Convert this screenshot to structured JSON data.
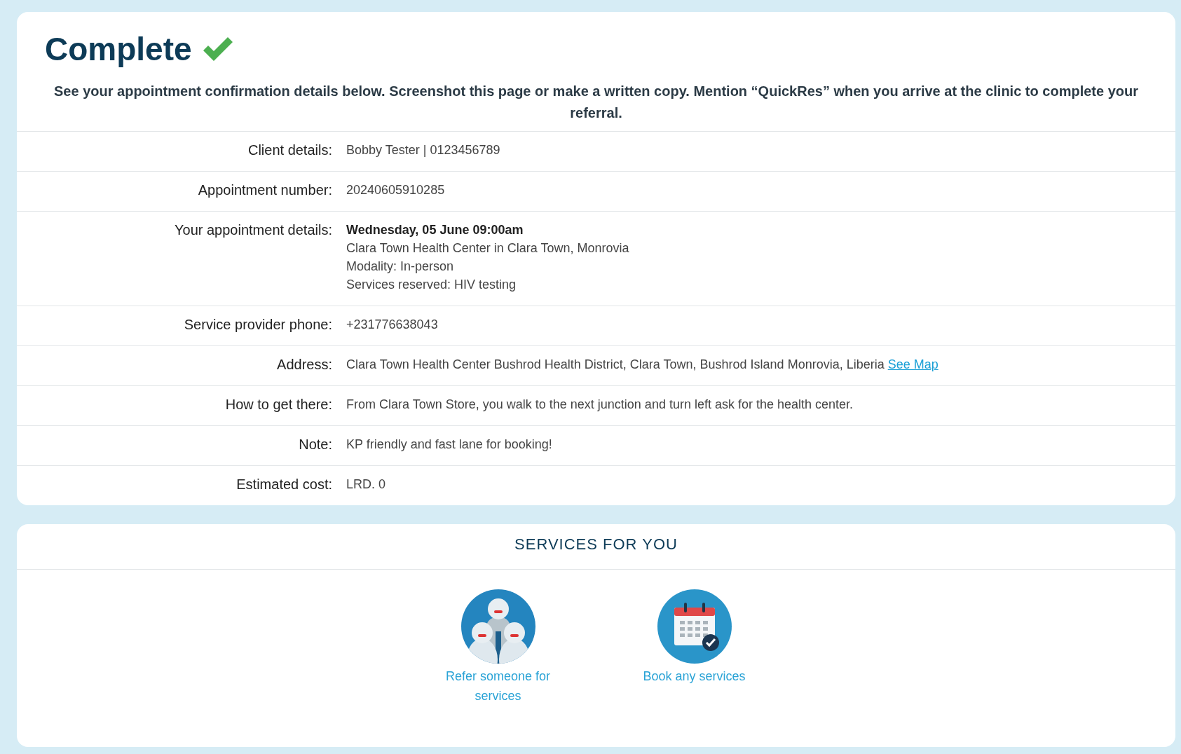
{
  "title": "Complete",
  "intro": "See your appointment confirmation details below. Screenshot this page or make a written copy. Mention “QuickRes” when you arrive at the clinic to complete your referral.",
  "details": [
    {
      "label": "Client details:",
      "lines": [
        {
          "text": "Bobby Tester | 0123456789",
          "bold": false
        }
      ]
    },
    {
      "label": "Appointment number:",
      "lines": [
        {
          "text": "20240605910285",
          "bold": false
        }
      ]
    },
    {
      "label": "Your appointment details:",
      "lines": [
        {
          "text": "Wednesday, 05 June 09:00am",
          "bold": true
        },
        {
          "text": "Clara Town Health Center in Clara Town, Monrovia",
          "bold": false
        },
        {
          "text": "Modality: In-person",
          "bold": false
        },
        {
          "text": "Services reserved: HIV testing",
          "bold": false
        }
      ]
    },
    {
      "label": "Service provider phone:",
      "lines": [
        {
          "text": "+231776638043",
          "bold": false
        }
      ]
    },
    {
      "label": "Address:",
      "lines": [
        {
          "text": "Clara Town Health Center Bushrod Health District, Clara Town, Bushrod Island Monrovia, Liberia",
          "bold": false,
          "link": "See Map"
        }
      ]
    },
    {
      "label": "How to get there:",
      "lines": [
        {
          "text": "From Clara Town Store, you walk to the next junction and turn left ask for the health center.",
          "bold": false
        }
      ]
    },
    {
      "label": "Note:",
      "lines": [
        {
          "text": "KP friendly and fast lane for booking!",
          "bold": false
        }
      ]
    },
    {
      "label": "Estimated cost:",
      "lines": [
        {
          "text": "LRD. 0",
          "bold": false
        }
      ]
    }
  ],
  "services": {
    "heading": "SERVICES FOR YOU",
    "items": [
      {
        "kind": "people",
        "label": "Refer someone for services"
      },
      {
        "kind": "calendar",
        "label": "Book any services"
      }
    ]
  }
}
